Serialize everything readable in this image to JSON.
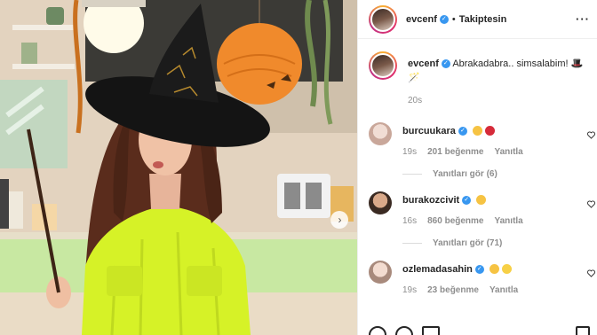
{
  "header": {
    "username": "evcenf",
    "separator": "•",
    "follow_state": "Takiptesin",
    "more_icon": "more-icon"
  },
  "caption": {
    "username": "evcenf",
    "text": "Abrakadabra.. simsalabim! 🎩🪄",
    "time": "20s"
  },
  "comments": [
    {
      "username": "burcuukara",
      "emojis": [
        "😂",
        "❤️"
      ],
      "time": "19s",
      "likes": "201 beğenme",
      "reply": "Yanıtla",
      "view_replies": "Yanıtları gör (6)"
    },
    {
      "username": "burakozcivit",
      "emojis": [
        "🤩"
      ],
      "time": "16s",
      "likes": "860 beğenme",
      "reply": "Yanıtla",
      "view_replies": "Yanıtları gör (71)"
    },
    {
      "username": "ozlemadasahin",
      "emojis": [
        "🥰",
        "💛"
      ],
      "time": "19s",
      "likes": "23 beğenme",
      "reply": "Yanıtla"
    }
  ],
  "colors": {
    "verified": "#3897f0",
    "text": "#262626",
    "muted": "#8e8e8e",
    "jumpsuit": "#d6f227"
  },
  "photo": {
    "next_icon": "chevron-right-icon"
  }
}
